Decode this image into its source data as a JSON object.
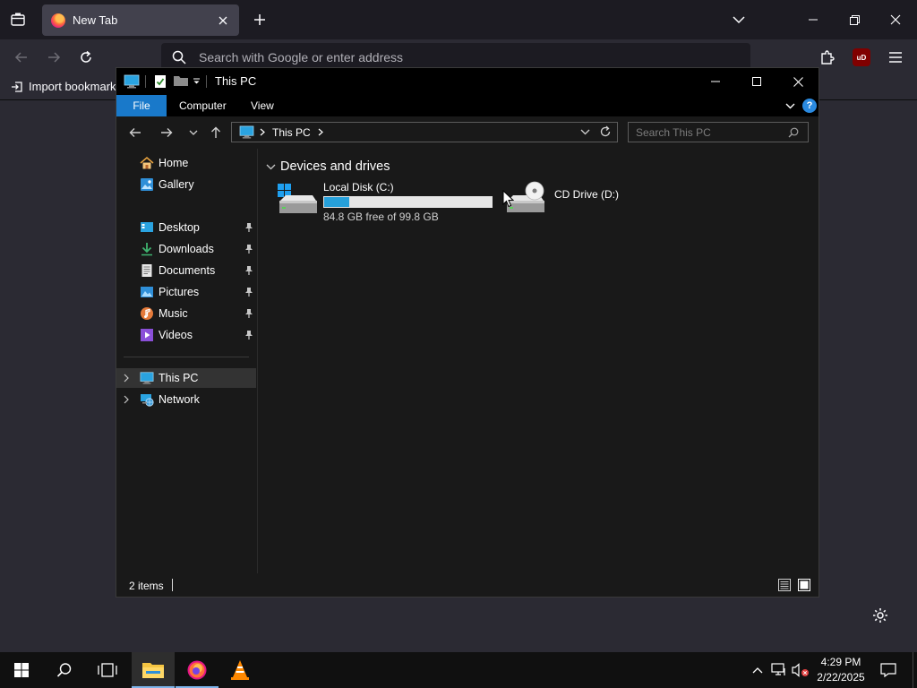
{
  "browser": {
    "tab_title": "New Tab",
    "url_placeholder": "Search with Google or enter address",
    "bookmark_import_label": "Import bookmarks...",
    "ublock_badge": "uD"
  },
  "explorer": {
    "title": "This PC",
    "ribbon": {
      "file": "File",
      "computer": "Computer",
      "view": "View",
      "help": "?"
    },
    "address": {
      "crumb": "This PC"
    },
    "search_placeholder": "Search This PC",
    "nav": {
      "home": "Home",
      "gallery": "Gallery",
      "desktop": "Desktop",
      "downloads": "Downloads",
      "documents": "Documents",
      "pictures": "Pictures",
      "music": "Music",
      "videos": "Videos",
      "this_pc": "This PC",
      "network": "Network"
    },
    "group_header": "Devices and drives",
    "drives": [
      {
        "name": "Local Disk (C:)",
        "free_text": "84.8 GB free of 99.8 GB",
        "used_fraction": 0.15
      },
      {
        "name": "CD Drive (D:)"
      }
    ],
    "status": "2 items"
  },
  "taskbar": {
    "time": "4:29 PM",
    "date": "2/22/2025"
  },
  "colors": {
    "accent": "#1979ca",
    "drive_bar": "#26a0da",
    "selected": "#333333"
  }
}
